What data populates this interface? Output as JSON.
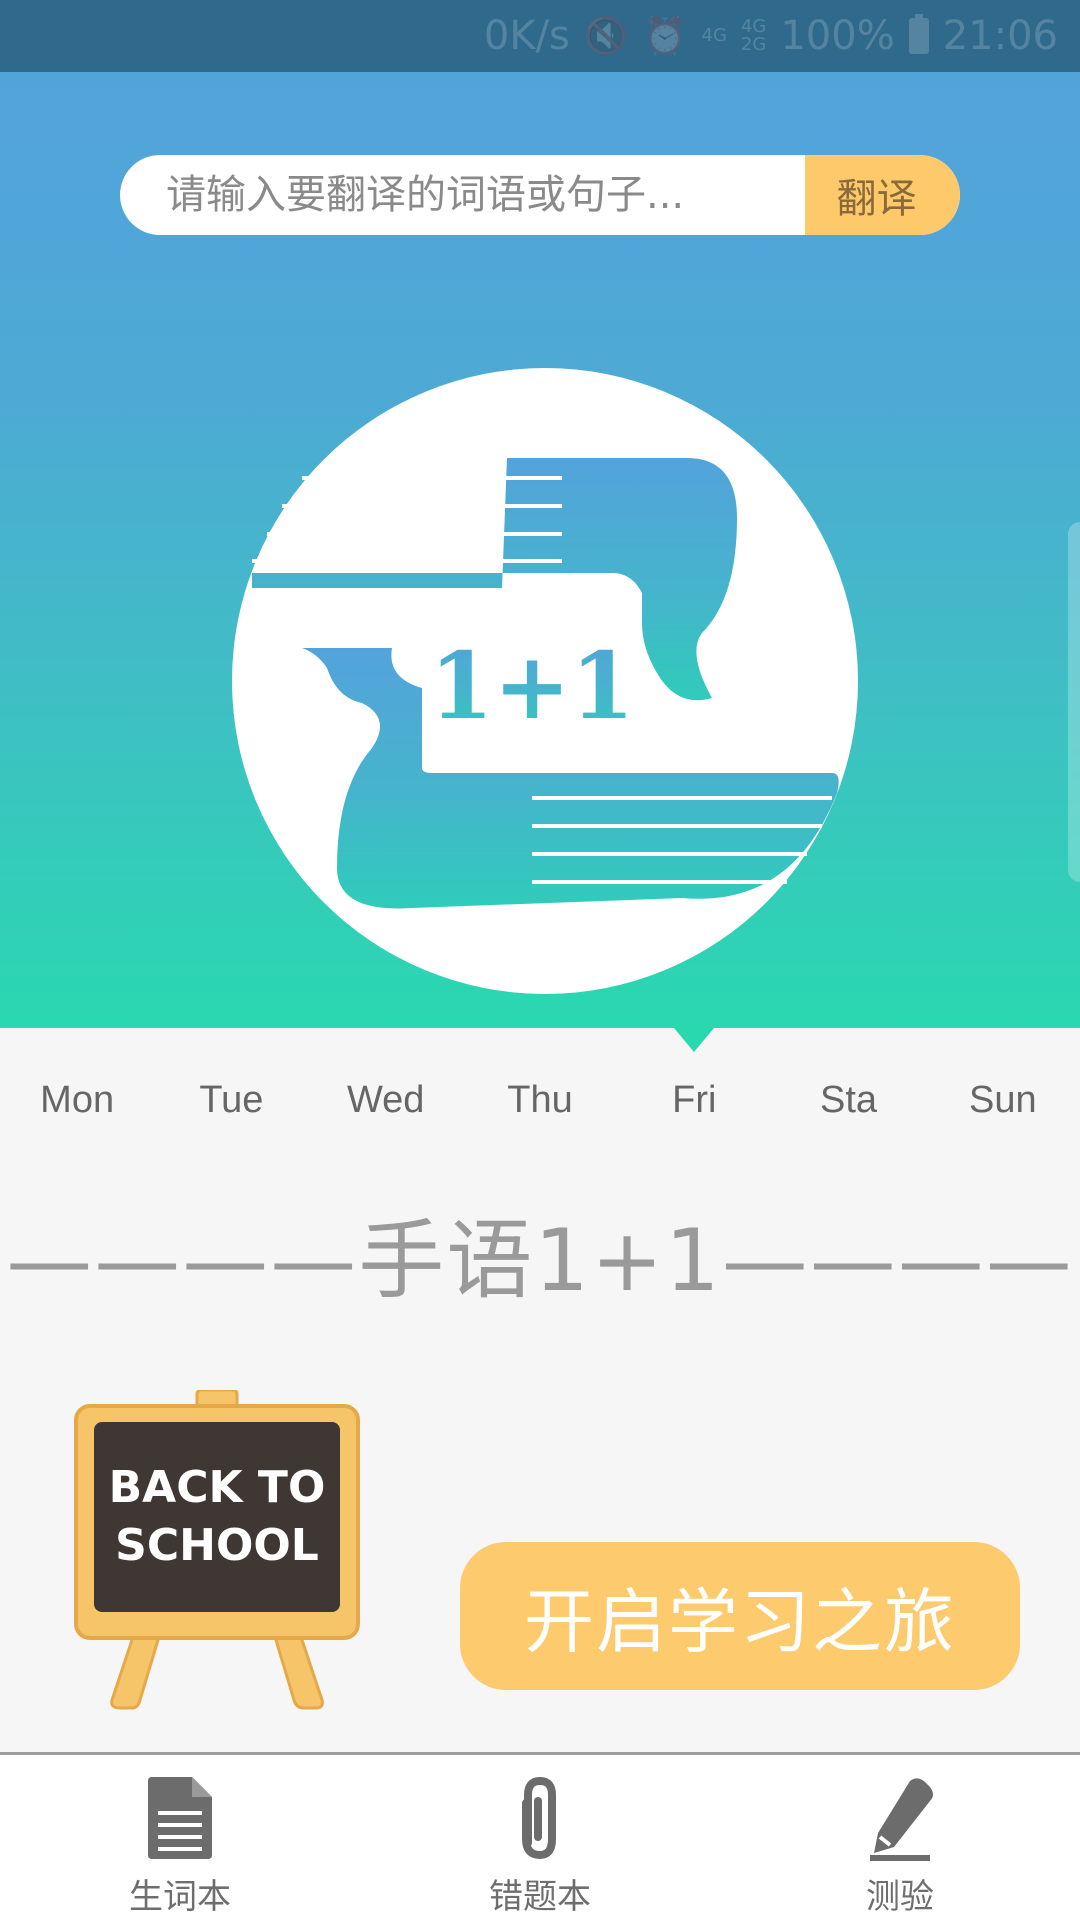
{
  "status_bar": {
    "net_speed": "0K/s",
    "net_top": "4G",
    "net_combo_top": "4G",
    "net_combo_bottom": "2G",
    "battery": "100%",
    "time": "21:06"
  },
  "search": {
    "placeholder": "请输入要翻译的词语或句子...",
    "button_label": "翻译"
  },
  "logo": {
    "text": "1+1"
  },
  "week": {
    "days": [
      "Mon",
      "Tue",
      "Wed",
      "Thu",
      "Fri",
      "Sta",
      "Sun"
    ],
    "selected": "Fri"
  },
  "slogan": "————手语1+1————",
  "board": {
    "line1": "BACK TO",
    "line2": "SCHOOL"
  },
  "start_button": "开启学习之旅",
  "bottom_nav": {
    "items": [
      {
        "label": "生词本",
        "icon": "document-icon"
      },
      {
        "label": "错题本",
        "icon": "paperclip-icon"
      },
      {
        "label": "测验",
        "icon": "pencil-icon"
      }
    ]
  },
  "colors": {
    "accent": "#fdc96a",
    "hero_top": "#53a3db",
    "hero_bottom": "#2ad8b0"
  }
}
